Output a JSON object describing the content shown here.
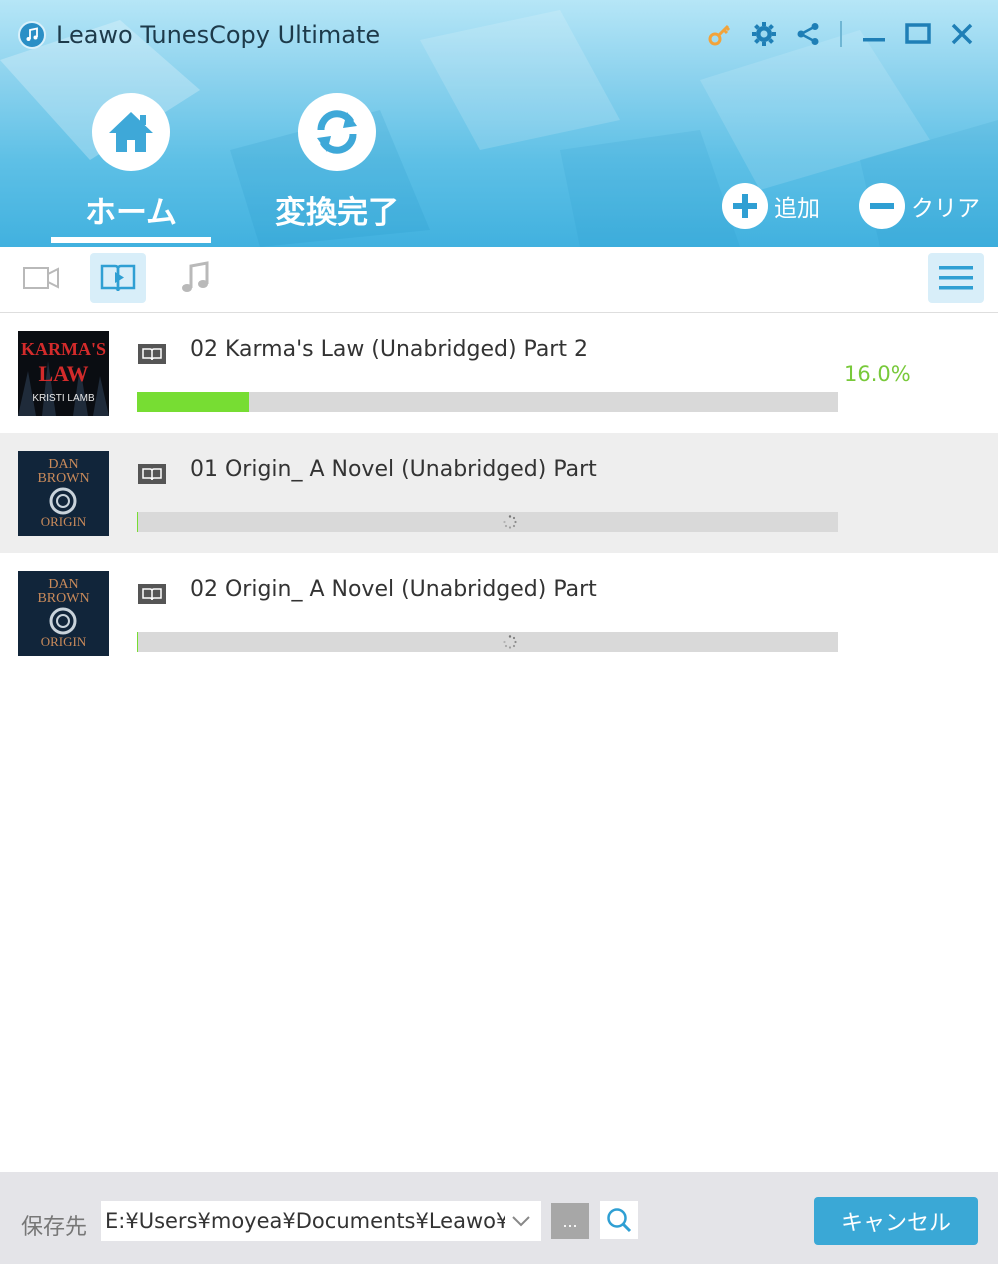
{
  "app": {
    "title": "Leawo TunesCopy Ultimate"
  },
  "window_controls": [
    "key-icon",
    "settings-icon",
    "share-icon",
    "minimize-icon",
    "maximize-icon",
    "close-icon"
  ],
  "nav": {
    "tabs": [
      {
        "label": "ホーム",
        "icon": "home-icon",
        "active": true
      },
      {
        "label": "変換完了",
        "icon": "convert-icon",
        "active": false
      }
    ],
    "add_label": "追加",
    "clear_label": "クリア"
  },
  "toolbar": {
    "media_tabs": [
      {
        "icon": "video-icon",
        "active": false
      },
      {
        "icon": "audiobook-icon",
        "active": true
      },
      {
        "icon": "music-icon",
        "active": false
      }
    ],
    "menu_icon": "menu-icon"
  },
  "items": [
    {
      "title": "02 Karma's Law (Unabridged) Part 2",
      "progress": 0.16,
      "progress_text": "16.0%",
      "status": "converting",
      "cover": {
        "line1": "KARMA'S",
        "line2": "LAW",
        "line3": "KRISTI LAMB"
      }
    },
    {
      "title": "01 Origin_ A Novel (Unabridged) Part",
      "progress": 0.0,
      "progress_text": "",
      "status": "waiting",
      "cover": {
        "line1": "DAN",
        "line2": "BROWN",
        "line3": "ORIGIN"
      }
    },
    {
      "title": "02 Origin_ A Novel (Unabridged) Part",
      "progress": 0.0,
      "progress_text": "",
      "status": "waiting",
      "cover": {
        "line1": "DAN",
        "line2": "BROWN",
        "line3": "ORIGIN"
      }
    }
  ],
  "footer": {
    "save_label": "保存先",
    "path": "E:¥Users¥moyea¥Documents¥Leawo¥",
    "browse_label": "...",
    "cancel_label": "キャンセル"
  },
  "colors": {
    "accent": "#3aa8d6",
    "progress": "#77dd33",
    "percent_text": "#78c93a",
    "key_icon": "#f2a33a"
  }
}
